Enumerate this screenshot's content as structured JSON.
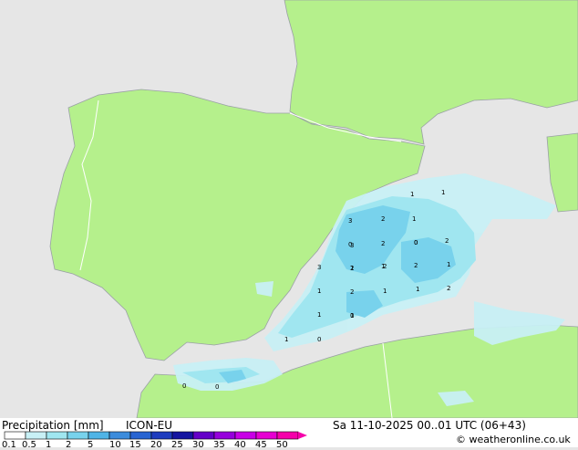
{
  "title": {
    "left": "Precipitation [mm]",
    "model": "ICON-EU",
    "datetime": "Sa 11-10-2025 00..01 UTC (06+43)",
    "credit": "© weatheronline.co.uk"
  },
  "colors": {
    "sea": "#e6e6e6",
    "land": "#b5f08c",
    "coast": "#9aa0a6",
    "border": "#ffffff"
  },
  "legend": {
    "ticks": [
      "0.1",
      "0.5",
      "1",
      "2",
      "5",
      "10",
      "15",
      "20",
      "25",
      "30",
      "35",
      "40",
      "45",
      "50"
    ],
    "colors": [
      "#ffffff",
      "#c8f0f5",
      "#a0e6f0",
      "#78d2ec",
      "#50b4e6",
      "#3c8cdc",
      "#2864d2",
      "#1e3cbe",
      "#1414a0",
      "#6400c8",
      "#9600dc",
      "#c800e6",
      "#e600d2",
      "#f500aa"
    ]
  },
  "precip_values": [
    "1",
    "1",
    "3",
    "2",
    "1",
    "3",
    "2",
    "0",
    "2",
    "3",
    "2",
    "1",
    "0",
    "2",
    "1",
    "2",
    "1",
    "1",
    "2",
    "2",
    "1",
    "1",
    "1",
    "0",
    "1",
    "0",
    "1",
    "0",
    "0",
    "0"
  ]
}
